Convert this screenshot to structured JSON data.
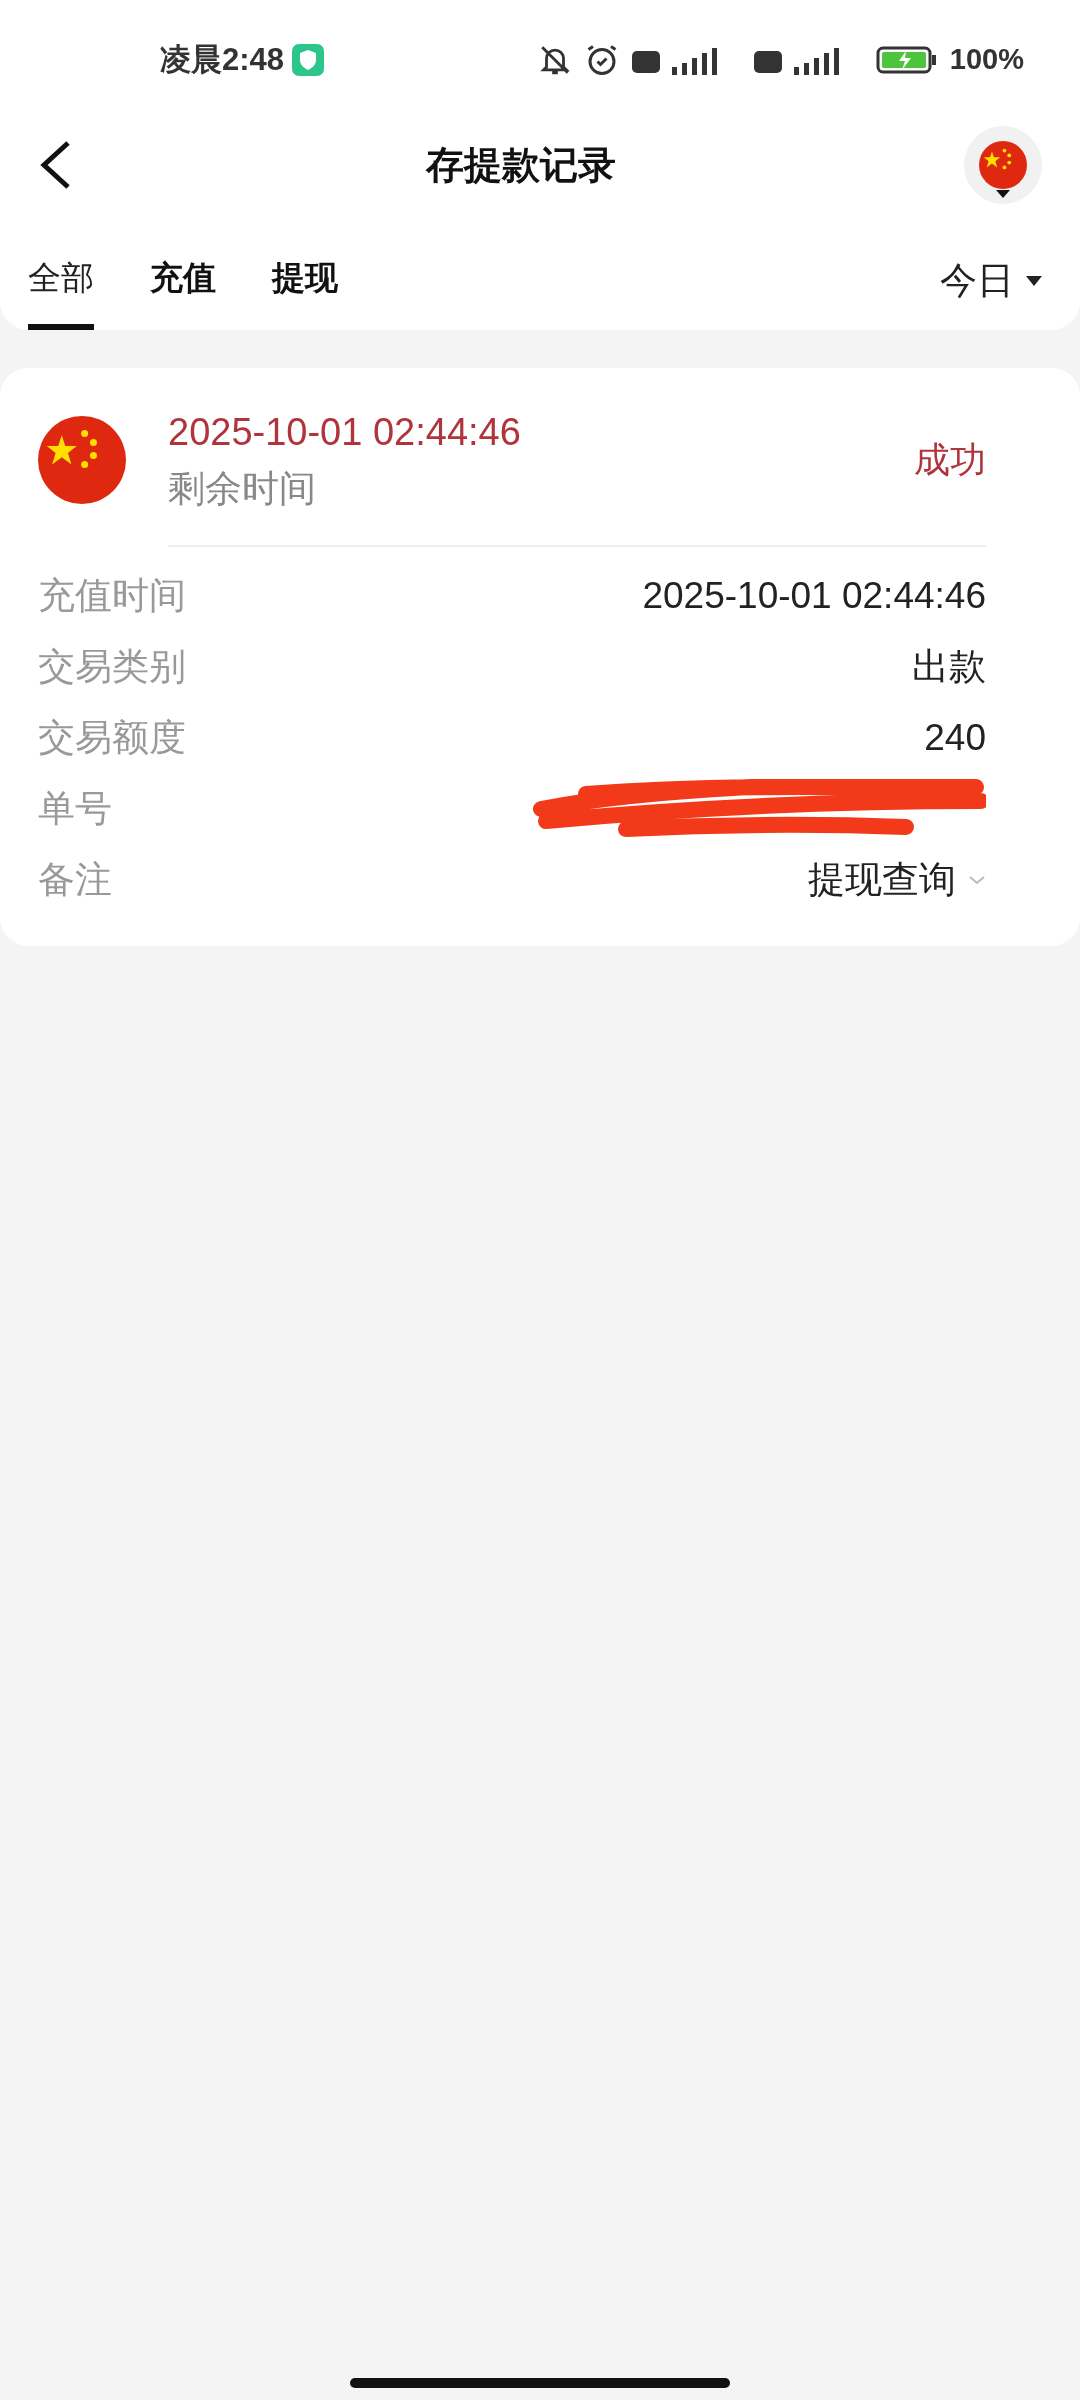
{
  "status_bar": {
    "time": "凌晨2:48",
    "battery": "100%"
  },
  "header": {
    "title": "存提款记录"
  },
  "tabs": [
    {
      "label": "全部",
      "selected": true
    },
    {
      "label": "充值",
      "selected": false
    },
    {
      "label": "提现",
      "selected": false
    }
  ],
  "date_filter": {
    "label": "今日"
  },
  "record": {
    "datetime": "2025-10-01 02:44:46",
    "subtitle": "剩余时间",
    "status": "成功",
    "fields": [
      {
        "label": "充值时间",
        "value": "2025-10-01 02:44:46",
        "kind": "text"
      },
      {
        "label": "交易类别",
        "value": "出款",
        "kind": "text"
      },
      {
        "label": "交易额度",
        "value": "240",
        "kind": "text"
      },
      {
        "label": "单号",
        "kind": "redacted"
      },
      {
        "label": "备注",
        "value": "提现查询",
        "kind": "dropdown"
      }
    ]
  }
}
